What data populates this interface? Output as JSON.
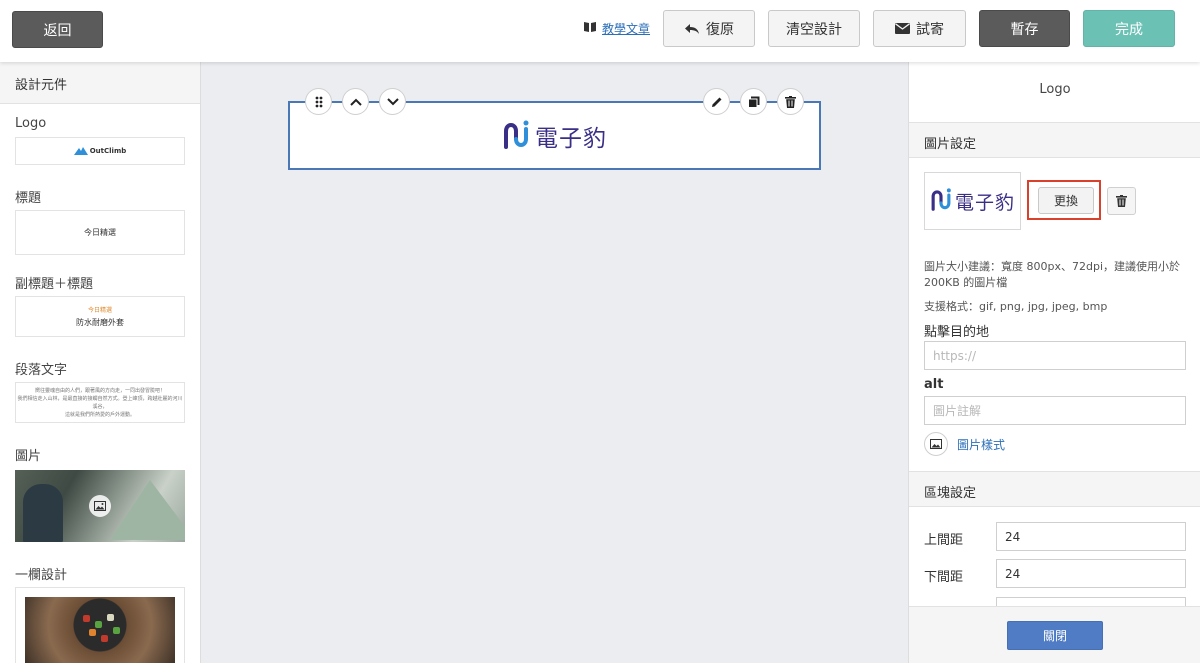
{
  "header": {
    "back_label": "返回",
    "tutorial_label": "教學文章",
    "restore_label": "復原",
    "clear_label": "清空設計",
    "test_send_label": "試寄",
    "save_draft_label": "暫存",
    "done_label": "完成"
  },
  "left_panel": {
    "title": "設計元件",
    "components": [
      {
        "label": "Logo",
        "preview": "OutClimb"
      },
      {
        "label": "標題",
        "preview": "今日精選"
      },
      {
        "label": "副標題＋標題",
        "preview_sub": "今日精選",
        "preview": "防水耐磨外套"
      },
      {
        "label": "段落文字",
        "preview_lines": [
          "嚮往靈魂自由的人們，跟著風的方向走，一同出發冒險吧！",
          "我們相信走入山林，是最直接的接觸自然方式。登上峰頂，跨越壯麗的河川溪谷，",
          "這就是我們所熱愛的戶外運動。"
        ]
      },
      {
        "label": "圖片"
      },
      {
        "label": "一欄設計"
      }
    ]
  },
  "canvas": {
    "logo_text": "電子豹"
  },
  "right_panel": {
    "title": "Logo",
    "image_section_title": "圖片設定",
    "thumb_text": "電子豹",
    "change_label": "更換",
    "size_hint": "圖片大小建議：寬度 800px、72dpi，建議使用小於 200KB 的圖片檔",
    "format_hint": "支援格式：gif, png, jpg, jpeg, bmp",
    "link_label": "點擊目的地",
    "link_placeholder": "https://",
    "alt_label": "alt",
    "alt_placeholder": "圖片註解",
    "image_style_label": "圖片樣式",
    "block_section_title": "區塊設定",
    "top_spacing_label": "上間距",
    "top_spacing_value": "24",
    "bottom_spacing_label": "下間距",
    "bottom_spacing_value": "24",
    "close_label": "關閉"
  },
  "colors": {
    "accent_done": "#6cc1b5",
    "primary_blue": "#4f7cc4",
    "highlight_red": "#d9412c",
    "brand_purple": "#3a2f86"
  }
}
